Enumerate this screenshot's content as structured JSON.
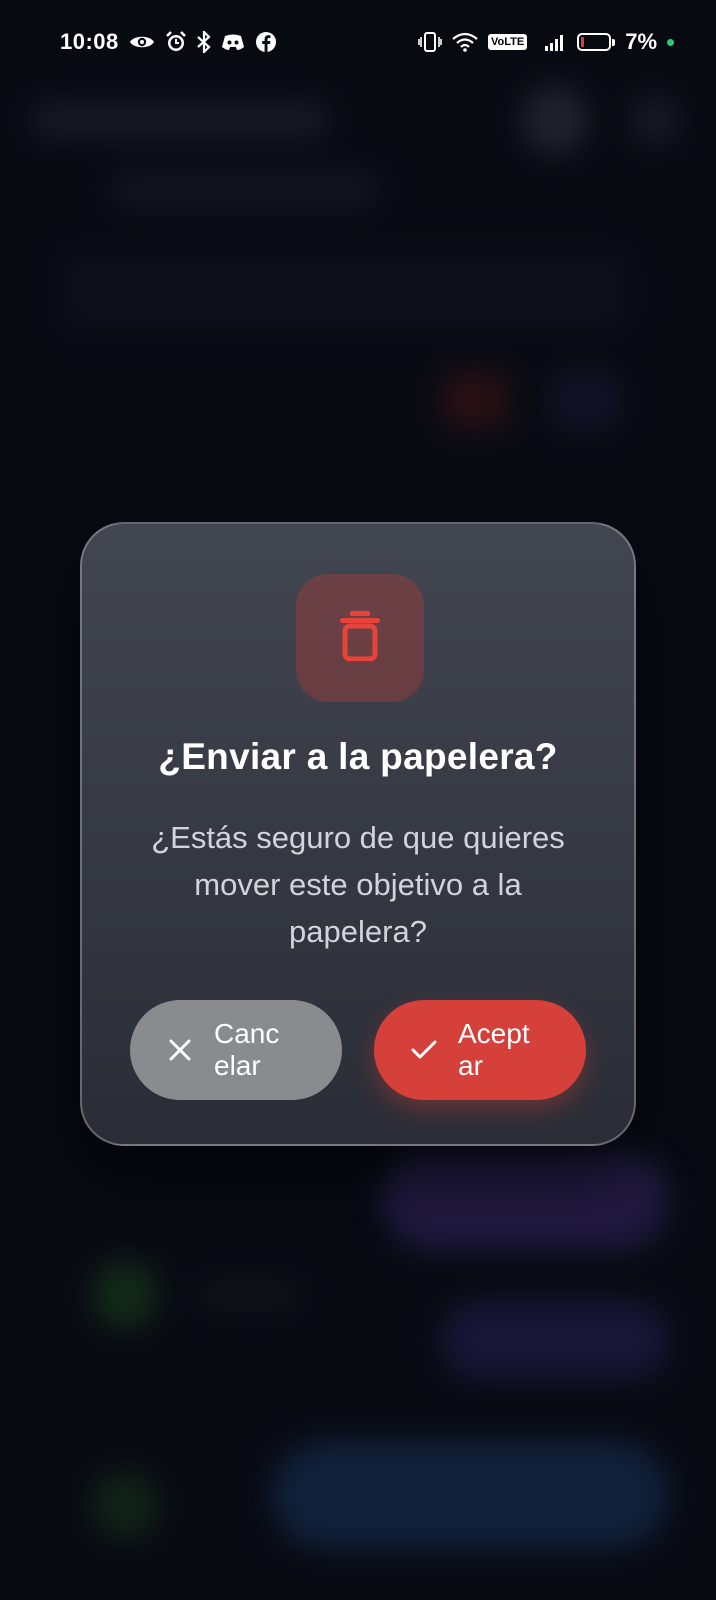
{
  "status_bar": {
    "time": "10:08",
    "left_icons": [
      "eye-icon",
      "alarm-icon",
      "bluetooth-icon",
      "discord-icon",
      "facebook-icon"
    ],
    "right_icons": [
      "vibrate-icon",
      "wifi-icon",
      "volte-icon",
      "signal-icon",
      "battery-icon"
    ],
    "volte_label": "VoLTE",
    "battery_percent": "7%",
    "battery_level": 0.07
  },
  "dialog": {
    "icon": "trash-icon",
    "title": "¿Enviar a la papelera?",
    "message": "¿Estás seguro de que quieres mover este objetivo a la papelera?",
    "cancel_label": "Cancelar",
    "accept_label": "Aceptar"
  },
  "colors": {
    "accent_red": "#d6403a",
    "cancel_gray": "#8a8b8f",
    "trash_icon_red": "#e8433a",
    "status_dot_green": "#2ecc71"
  }
}
